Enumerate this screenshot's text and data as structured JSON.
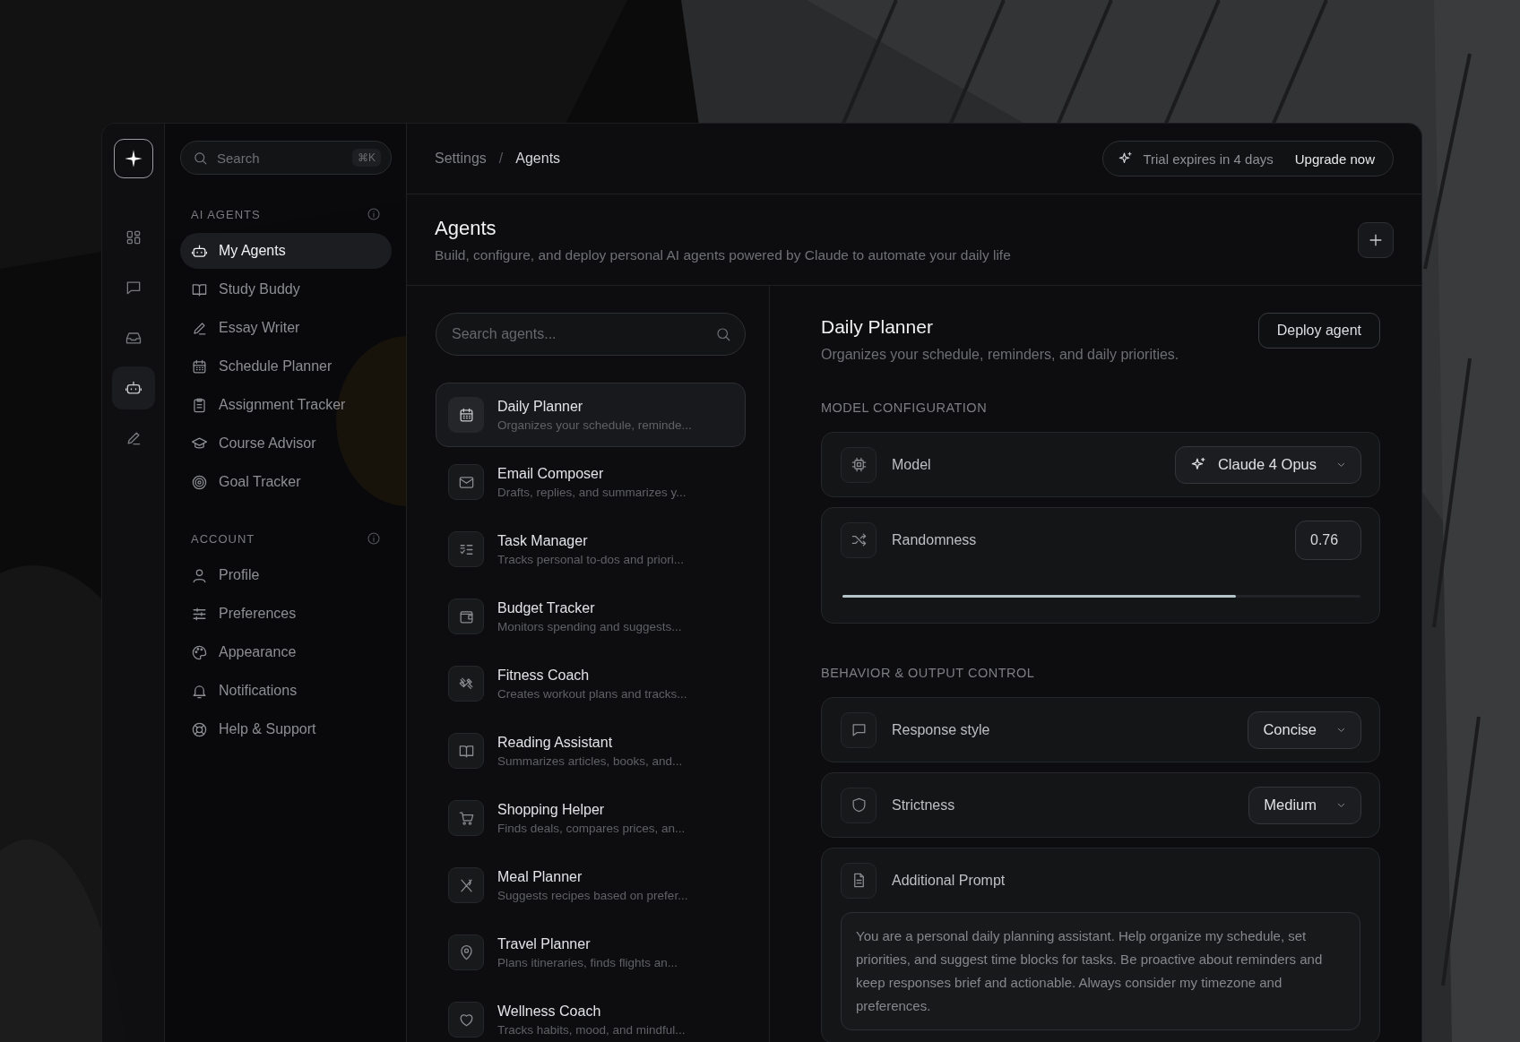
{
  "rail": [
    {
      "selected": false
    },
    {
      "selected": false
    },
    {
      "selected": false
    },
    {
      "selected": true
    },
    {
      "selected": false
    }
  ],
  "search": {
    "placeholder": "Search",
    "shortcut": "⌘K"
  },
  "sidebar": {
    "sections": [
      {
        "title": "AI AGENTS",
        "items": [
          {
            "label": "My Agents",
            "selected": true
          },
          {
            "label": "Study Buddy",
            "selected": false
          },
          {
            "label": "Essay Writer",
            "selected": false
          },
          {
            "label": "Schedule Planner",
            "selected": false
          },
          {
            "label": "Assignment Tracker",
            "selected": false
          },
          {
            "label": "Course Advisor",
            "selected": false
          },
          {
            "label": "Goal Tracker",
            "selected": false
          }
        ]
      },
      {
        "title": "ACCOUNT",
        "items": [
          {
            "label": "Profile",
            "selected": false
          },
          {
            "label": "Preferences",
            "selected": false
          },
          {
            "label": "Appearance",
            "selected": false
          },
          {
            "label": "Notifications",
            "selected": false
          },
          {
            "label": "Help & Support",
            "selected": false
          }
        ]
      }
    ]
  },
  "breadcrumb": {
    "items": [
      "Settings",
      "Agents"
    ],
    "separator": "/"
  },
  "trial": {
    "text": "Trial expires in 4 days",
    "action": "Upgrade now"
  },
  "page": {
    "title": "Agents",
    "subtitle": "Build, configure, and deploy personal AI agents powered by Claude to automate your daily life"
  },
  "agent_search": {
    "placeholder": "Search agents..."
  },
  "agents": [
    {
      "name": "Daily Planner",
      "description": "Organizes your schedule, reminde...",
      "selected": true
    },
    {
      "name": "Email Composer",
      "description": "Drafts, replies, and summarizes y...",
      "selected": false
    },
    {
      "name": "Task Manager",
      "description": "Tracks personal to-dos and priori...",
      "selected": false
    },
    {
      "name": "Budget Tracker",
      "description": "Monitors spending and suggests...",
      "selected": false
    },
    {
      "name": "Fitness Coach",
      "description": "Creates workout plans and tracks...",
      "selected": false
    },
    {
      "name": "Reading Assistant",
      "description": "Summarizes articles, books, and...",
      "selected": false
    },
    {
      "name": "Shopping Helper",
      "description": "Finds deals, compares prices, an...",
      "selected": false
    },
    {
      "name": "Meal Planner",
      "description": "Suggests recipes based on prefer...",
      "selected": false
    },
    {
      "name": "Travel Planner",
      "description": "Plans itineraries, finds flights an...",
      "selected": false
    },
    {
      "name": "Wellness Coach",
      "description": "Tracks habits, mood, and mindful...",
      "selected": false
    }
  ],
  "detail": {
    "title": "Daily Planner",
    "description": "Organizes your schedule, reminders, and daily priorities.",
    "deploy": "Deploy agent",
    "sections": [
      {
        "title": "MODEL CONFIGURATION",
        "rows": [
          {
            "kind": "select",
            "label": "Model",
            "value": "Claude 4 Opus"
          },
          {
            "kind": "slider",
            "label": "Randomness",
            "value": "0.76",
            "level": 0.76
          }
        ]
      },
      {
        "title": "BEHAVIOR & OUTPUT CONTROL",
        "rows": [
          {
            "kind": "select",
            "label": "Response style",
            "value": "Concise"
          },
          {
            "kind": "select",
            "label": "Strictness",
            "value": "Medium"
          },
          {
            "kind": "text",
            "label": "Additional Prompt",
            "value": "You are a personal daily planning assistant. Help organize my schedule, set priorities, and suggest time blocks for tasks. Be proactive about reminders and keep responses brief and actionable. Always consider my timezone and preferences."
          }
        ]
      }
    ]
  }
}
